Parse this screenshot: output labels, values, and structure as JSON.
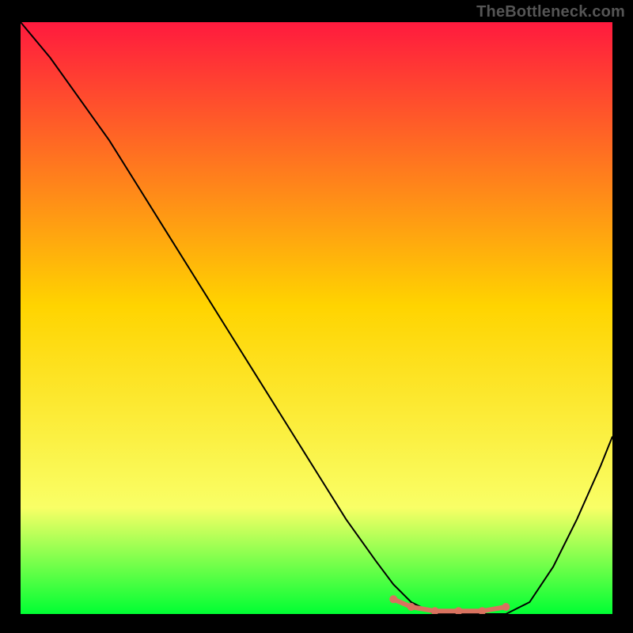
{
  "watermark": "TheBottleneck.com",
  "colors": {
    "background": "#000000",
    "gradient_top": "#ff1a3e",
    "gradient_mid": "#ffd400",
    "gradient_low": "#f9ff66",
    "gradient_bottom": "#00ff33",
    "curve": "#000000",
    "marker": "#d9725f"
  },
  "chart_data": {
    "type": "line",
    "title": "",
    "xlabel": "",
    "ylabel": "",
    "xlim": [
      0,
      100
    ],
    "ylim": [
      0,
      100
    ],
    "grid": false,
    "legend": false,
    "series": [
      {
        "name": "bottleneck-curve",
        "x": [
          0,
          5,
          10,
          15,
          20,
          25,
          30,
          35,
          40,
          45,
          50,
          55,
          60,
          63,
          66,
          70,
          74,
          78,
          82,
          86,
          90,
          94,
          98,
          100
        ],
        "y": [
          100,
          94,
          87,
          80,
          72,
          64,
          56,
          48,
          40,
          32,
          24,
          16,
          9,
          5,
          2,
          0,
          0,
          0,
          0,
          2,
          8,
          16,
          25,
          30
        ]
      },
      {
        "name": "flat-bottom-markers",
        "x": [
          63,
          66,
          70,
          74,
          78,
          82
        ],
        "y": [
          2.5,
          1.2,
          0.5,
          0.5,
          0.5,
          1.2
        ]
      }
    ],
    "annotations": []
  }
}
